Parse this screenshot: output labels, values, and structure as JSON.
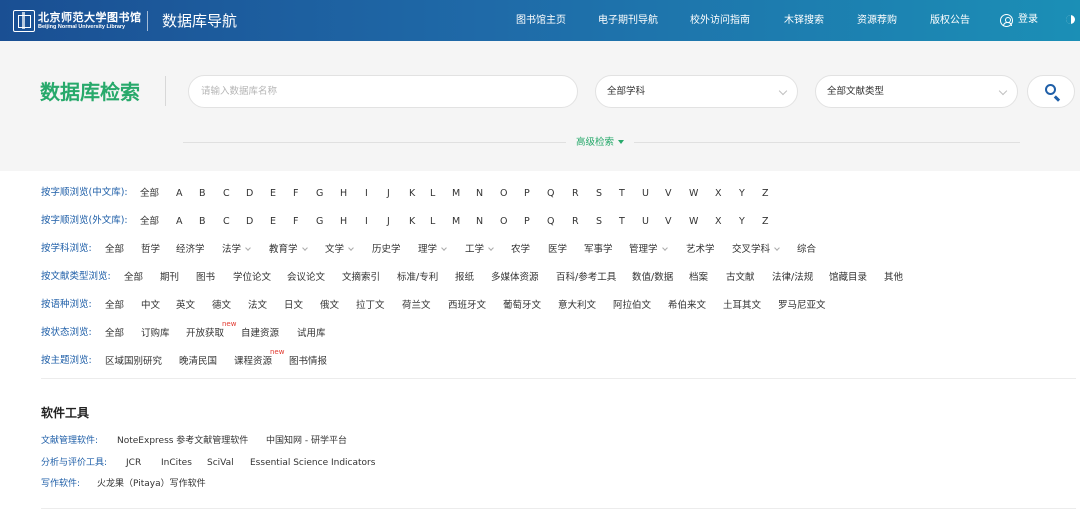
{
  "header": {
    "logo_cn": "北京师范大学图书馆",
    "logo_en": "Beijing Normal University Library",
    "site_title": "数据库导航",
    "nav": [
      "图书馆主页",
      "电子期刊导航",
      "校外访问指南",
      "木铎搜索",
      "资源荐购",
      "版权公告"
    ],
    "login_label": "登录"
  },
  "search": {
    "title": "数据库检索",
    "input_placeholder": "请输入数据库名称",
    "input_value": "",
    "subject_select": "全部学科",
    "doctype_select": "全部文献类型",
    "advanced_label": "高级检索"
  },
  "browse": {
    "cn_order": {
      "label": "按字顺浏览(中文库):",
      "items": [
        "全部",
        "A",
        "B",
        "C",
        "D",
        "E",
        "F",
        "G",
        "H",
        "I",
        "J",
        "K",
        "L",
        "M",
        "N",
        "O",
        "P",
        "Q",
        "R",
        "S",
        "T",
        "U",
        "V",
        "W",
        "X",
        "Y",
        "Z"
      ]
    },
    "en_order": {
      "label": "按字顺浏览(外文库):",
      "items": [
        "全部",
        "A",
        "B",
        "C",
        "D",
        "E",
        "F",
        "G",
        "H",
        "I",
        "J",
        "K",
        "L",
        "M",
        "N",
        "O",
        "P",
        "Q",
        "R",
        "S",
        "T",
        "U",
        "V",
        "W",
        "X",
        "Y",
        "Z"
      ]
    },
    "subject": {
      "label": "按学科浏览:",
      "items": [
        "全部",
        "哲学",
        "经济学",
        "法学",
        "教育学",
        "文学",
        "历史学",
        "理学",
        "工学",
        "农学",
        "医学",
        "军事学",
        "管理学",
        "艺术学",
        "交叉学科",
        "综合"
      ]
    },
    "doctype": {
      "label": "按文献类型浏览:",
      "items": [
        "全部",
        "期刊",
        "图书",
        "学位论文",
        "会议论文",
        "文摘索引",
        "标准/专利",
        "报纸",
        "多媒体资源",
        "百科/参考工具",
        "数值/数据",
        "档案",
        "古文献",
        "法律/法规",
        "馆藏目录",
        "其他"
      ]
    },
    "language": {
      "label": "按语种浏览:",
      "items": [
        "全部",
        "中文",
        "英文",
        "德文",
        "法文",
        "日文",
        "俄文",
        "拉丁文",
        "荷兰文",
        "西班牙文",
        "葡萄牙文",
        "意大利文",
        "阿拉伯文",
        "希伯来文",
        "土耳其文",
        "罗马尼亚文"
      ]
    },
    "status": {
      "label": "按状态浏览:",
      "items": [
        "全部",
        "订购库",
        "开放获取",
        "自建资源",
        "试用库"
      ]
    },
    "topic": {
      "label": "按主题浏览:",
      "items": [
        "区域国别研究",
        "晚清民国",
        "课程资源",
        "图书情报"
      ]
    },
    "new_badge": "new"
  },
  "tools": {
    "title": "软件工具",
    "rows": [
      {
        "label": "文献管理软件:",
        "items": [
          "NoteExpress 参考文献管理软件",
          "中国知网 - 研学平台"
        ]
      },
      {
        "label": "分析与评价工具:",
        "items": [
          "JCR",
          "InCites",
          "SciVal",
          "Essential Science Indicators"
        ]
      },
      {
        "label": "写作软件:",
        "items": [
          "火龙果（Pitaya）写作软件"
        ]
      }
    ]
  },
  "colors": {
    "accent_green": "#27a96b",
    "link_blue": "#1f5fa8",
    "new_red": "#e2392f"
  }
}
